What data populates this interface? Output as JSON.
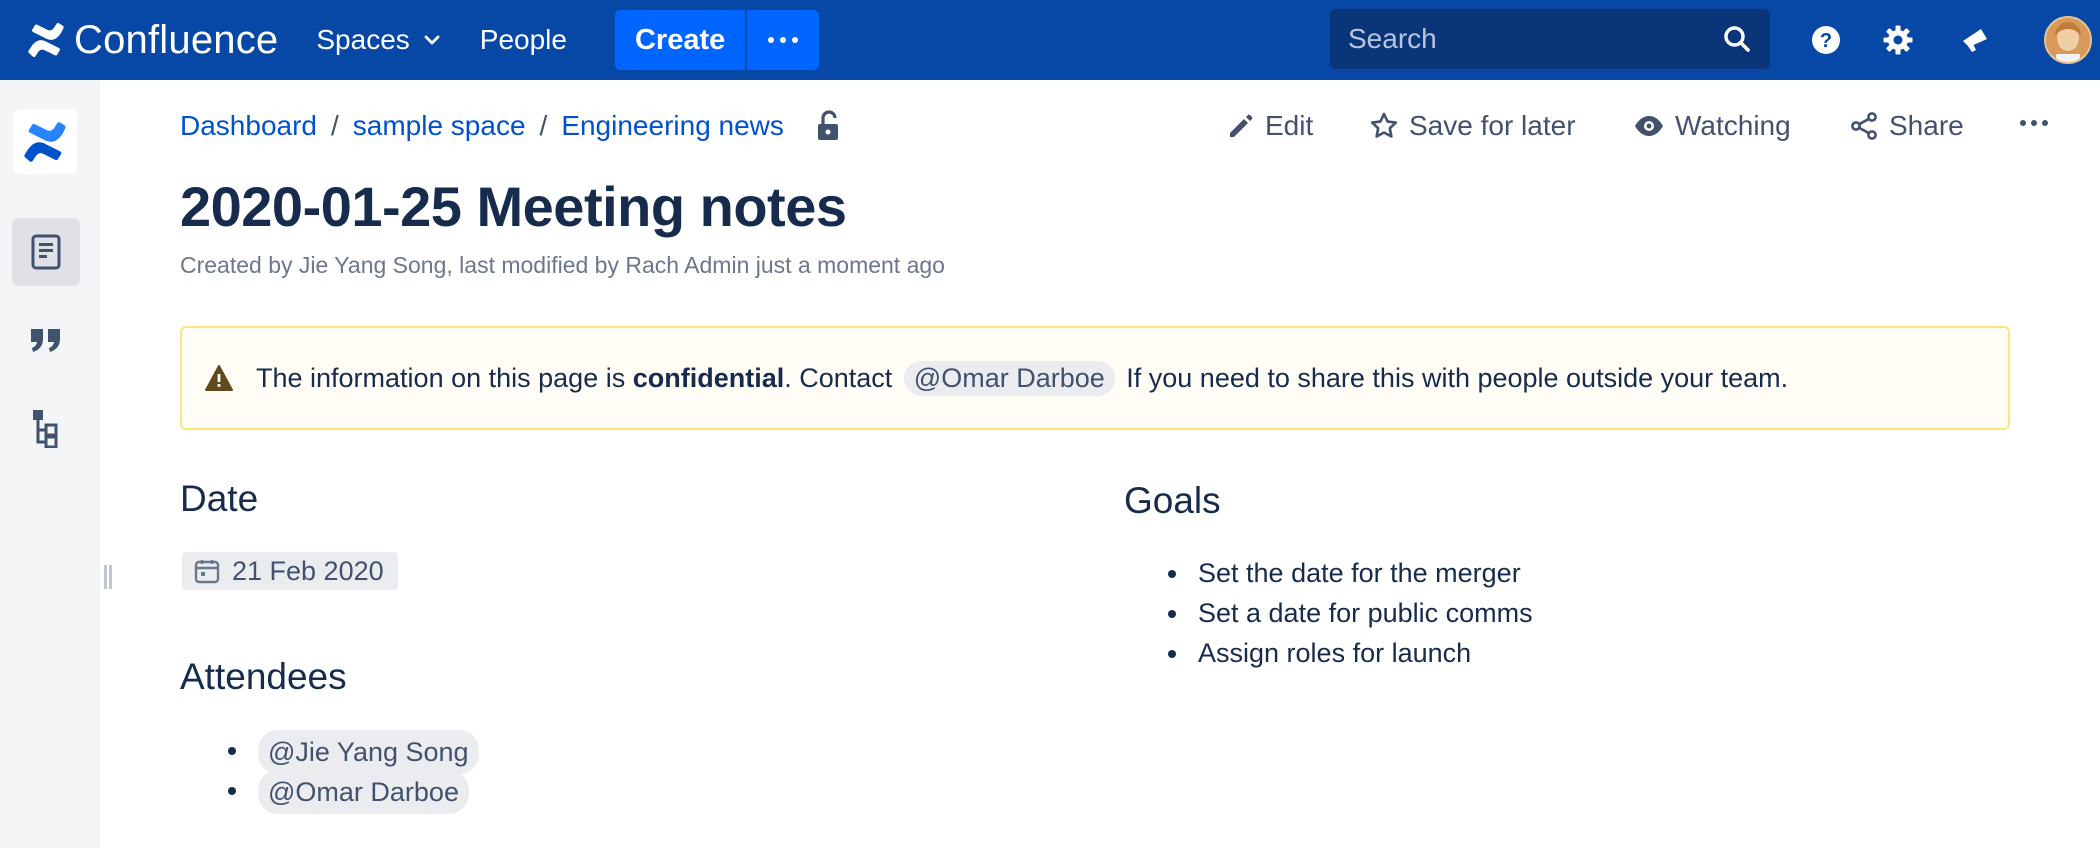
{
  "topnav": {
    "logo_text": "Confluence",
    "spaces_label": "Spaces",
    "people_label": "People",
    "create_label": "Create",
    "search_placeholder": "Search",
    "accent": "#0747a6",
    "create_color": "#0065ff"
  },
  "sidebar": {
    "items": [
      {
        "icon": "confluence-logo-icon"
      },
      {
        "icon": "pages-icon",
        "active": true
      },
      {
        "icon": "blog-quote-icon"
      },
      {
        "icon": "page-tree-icon"
      }
    ]
  },
  "breadcrumb": [
    "Dashboard",
    "sample space",
    "Engineering news"
  ],
  "breadcrumb_sep": "/",
  "actions": {
    "edit": "Edit",
    "save_for_later": "Save for later",
    "watching": "Watching",
    "share": "Share"
  },
  "page": {
    "title": "2020-01-25 Meeting notes",
    "byline": "Created by Jie Yang Song, last modified by Rach Admin just a moment ago"
  },
  "panel": {
    "before": "The information on this page is ",
    "bold": "confidential",
    "middle": ". Contact ",
    "mention": "@Omar Darboe",
    "after": " If you need to share this with people outside your team."
  },
  "sections": {
    "date_heading": "Date",
    "date_value": "21 Feb 2020",
    "attendees_heading": "Attendees",
    "attendees": [
      "@Jie Yang Song",
      "@Omar Darboe"
    ],
    "goals_heading": "Goals",
    "goals": [
      "Set the date for the merger",
      "Set a date for public comms",
      "Assign roles for launch"
    ]
  }
}
